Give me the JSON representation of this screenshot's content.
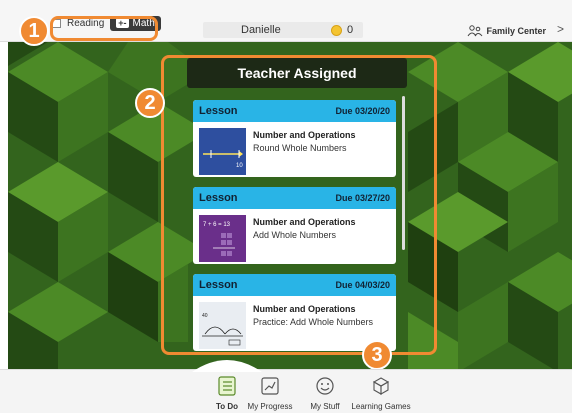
{
  "header": {
    "reading_label": "Reading",
    "math_label": "Math",
    "math_glyph": "+-",
    "user_name": "Danielle",
    "coin_count": "0",
    "family_center": "Family Center",
    "more_glyph": ">"
  },
  "panel": {
    "title": "Teacher Assigned",
    "cards": [
      {
        "type": "Lesson",
        "due": "Due 03/20/20",
        "title": "Number and Operations",
        "subtitle": "Round Whole Numbers",
        "thumb_label": "10"
      },
      {
        "type": "Lesson",
        "due": "Due 03/27/20",
        "title": "Number and Operations",
        "subtitle": "Add Whole Numbers",
        "thumb_label": "7 + 6 = 13"
      },
      {
        "type": "Lesson",
        "due": "Due 04/03/20",
        "title": "Number and Operations",
        "subtitle": "Practice: Add Whole Numbers",
        "thumb_label": "40"
      }
    ]
  },
  "callouts": [
    "1",
    "2",
    "3"
  ],
  "nav": [
    {
      "label": "To Do",
      "icon": "todo-list-icon"
    },
    {
      "label": "My Progress",
      "icon": "progress-chart-icon"
    },
    {
      "label": "My Stuff",
      "icon": "smiley-face-icon"
    },
    {
      "label": "Learning Games",
      "icon": "cube-games-icon"
    }
  ],
  "colors": {
    "accent": "#f08a32",
    "card_header": "#29b4e6",
    "panel_title_bg": "#1d2916",
    "background_green": "#33641d"
  }
}
